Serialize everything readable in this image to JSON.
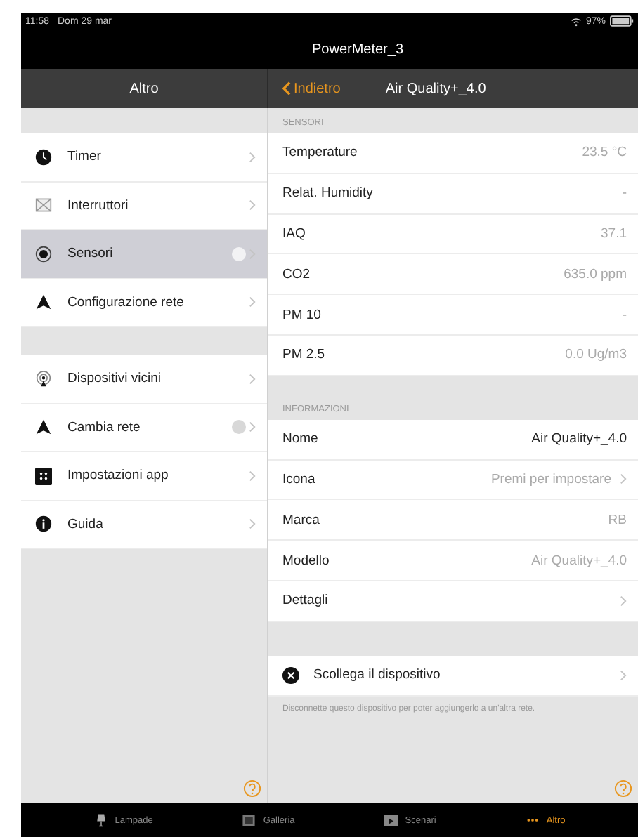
{
  "status_bar": {
    "time": "11:58",
    "date": "Dom 29 mar",
    "battery": "97%"
  },
  "window": {
    "title": "PowerMeter_3"
  },
  "master": {
    "title": "Altro",
    "groups": [
      [
        {
          "label": "Timer",
          "kind": "clock",
          "selected": false,
          "badge": false
        },
        {
          "label": "Interruttori",
          "kind": "switch",
          "selected": false,
          "badge": false
        },
        {
          "label": "Sensori",
          "kind": "sensor",
          "selected": true,
          "badge": true
        },
        {
          "label": "Configurazione rete",
          "kind": "arrow",
          "selected": false,
          "badge": false
        }
      ],
      [
        {
          "label": "Dispositivi vicini",
          "kind": "antenna",
          "selected": false,
          "badge": false
        },
        {
          "label": "Cambia rete",
          "kind": "arrow",
          "selected": false,
          "badge": true
        },
        {
          "label": "Impostazioni app",
          "kind": "grid",
          "selected": false,
          "badge": false
        },
        {
          "label": "Guida",
          "kind": "info",
          "selected": false,
          "badge": false
        }
      ]
    ]
  },
  "detail": {
    "back": "Indietro",
    "title": "Air Quality+_4.0",
    "sensors": {
      "header": "SENSORI",
      "rows": [
        {
          "label": "Temperature",
          "value": "23.5 °C"
        },
        {
          "label": "Relat. Humidity",
          "value": "-"
        },
        {
          "label": "IAQ",
          "value": "37.1"
        },
        {
          "label": "CO2",
          "value": "635.0 ppm"
        },
        {
          "label": "PM 10",
          "value": "-"
        },
        {
          "label": "PM 2.5",
          "value": "0.0 Ug/m3"
        }
      ]
    },
    "info": {
      "header": "INFORMAZIONI",
      "rows": [
        {
          "label": "Nome",
          "value": "Air Quality+_4.0",
          "dark": true,
          "chevron": false
        },
        {
          "label": "Icona",
          "value": "Premi per impostare",
          "dark": false,
          "chevron": true
        },
        {
          "label": "Marca",
          "value": "RB",
          "dark": false,
          "chevron": false
        },
        {
          "label": "Modello",
          "value": "Air Quality+_4.0",
          "dark": false,
          "chevron": false
        },
        {
          "label": "Dettagli",
          "chevron": true
        }
      ]
    },
    "disconnect": {
      "label": "Scollega il dispositivo",
      "note": "Disconnette questo dispositivo per poter aggiungerlo a un'altra rete."
    }
  },
  "tab_bar": [
    {
      "label": "Lampade",
      "kind": "lamp",
      "selected": false
    },
    {
      "label": "Galleria",
      "kind": "picture",
      "selected": false
    },
    {
      "label": "Scenari",
      "kind": "film",
      "selected": false
    },
    {
      "label": "Altro",
      "kind": "dots",
      "selected": true
    }
  ]
}
